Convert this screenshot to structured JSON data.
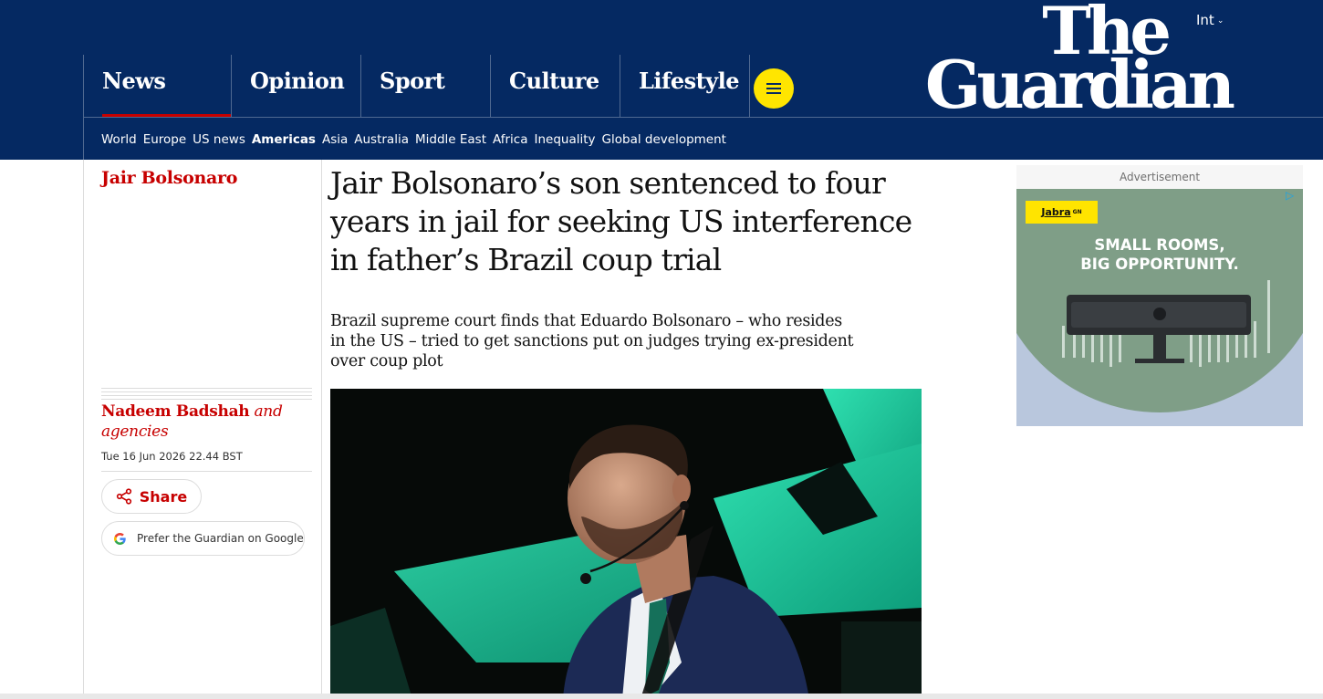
{
  "header": {
    "edition_label": "Int",
    "logo_line1": "The",
    "logo_line2": "Guardian",
    "pillars": [
      {
        "label": "News",
        "active": true
      },
      {
        "label": "Opinion"
      },
      {
        "label": "Sport"
      },
      {
        "label": "Culture"
      },
      {
        "label": "Lifestyle"
      }
    ],
    "subnav": [
      "World",
      "Europe",
      "US news",
      "Americas",
      "Asia",
      "Australia",
      "Middle East",
      "Africa",
      "Inequality",
      "Global development"
    ],
    "subnav_active": "Americas",
    "colors": {
      "brand": "#052962",
      "accent": "#c70000",
      "menu": "#ffe500"
    }
  },
  "article": {
    "kicker": "Jair Bolsonaro",
    "headline": "Jair Bolsonaro’s son sentenced to four years in jail for seeking US interference in father’s Brazil coup trial",
    "standfirst": "Brazil supreme court finds that Eduardo Bolsonaro – who resides in the US – tried to get sanctions put on judges trying ex-president over coup plot",
    "author": "Nadeem Badshah",
    "author_suffix": " and agencies",
    "dateline": "Tue 16 Jun 2026 22.44 BST",
    "share_label": "Share",
    "google_label": "Prefer the Guardian on Google"
  },
  "advert": {
    "label": "Advertisement",
    "brand": "Jabra",
    "brand_suffix": "GN",
    "headline_line1": "SMALL ROOMS,",
    "headline_line2": "BIG OPPORTUNITY."
  }
}
